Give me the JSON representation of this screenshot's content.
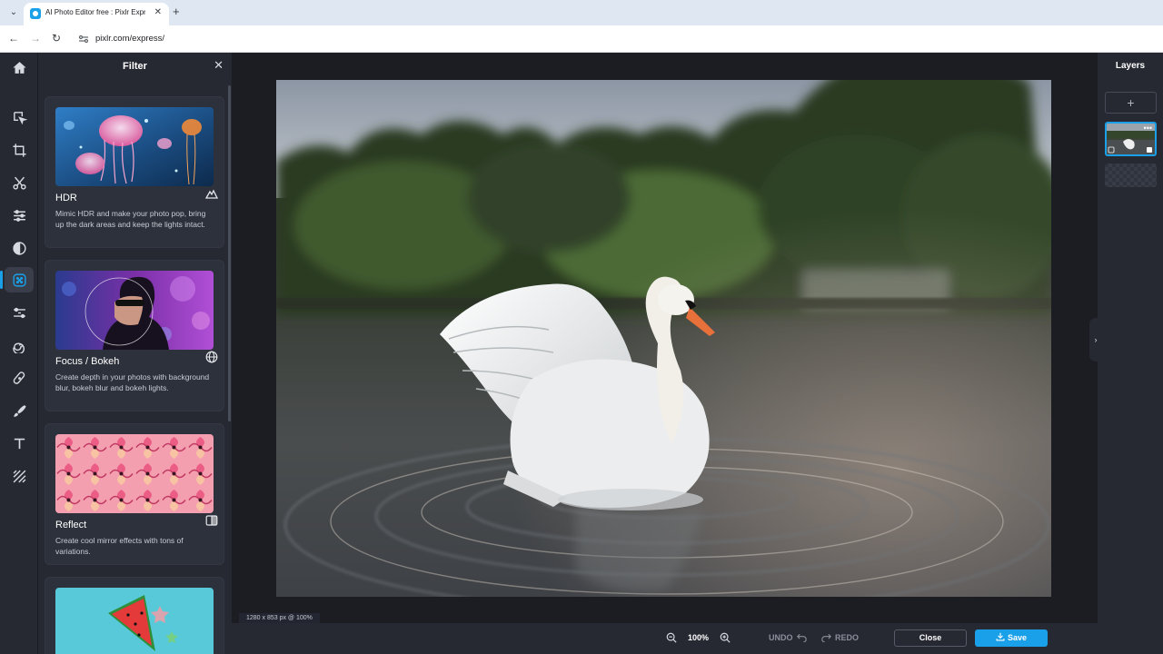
{
  "browser": {
    "tab_title": "AI Photo Editor free : Pixlr Expre",
    "tab_close": "✕",
    "new_tab": "+",
    "dropdown": "⌄",
    "url": "pixlr.com/express/",
    "back": "←",
    "forward": "→",
    "reload": "↻"
  },
  "toolbar": {
    "home": "home-icon",
    "tools": [
      "arrange",
      "crop",
      "cutout",
      "adjust",
      "filter",
      "effect",
      "liquify",
      "heal",
      "draw",
      "text",
      "pattern"
    ],
    "active": "filter"
  },
  "filter_panel": {
    "title": "Filter",
    "close": "✕",
    "cards": [
      {
        "name": "HDR",
        "description": "Mimic HDR and make your photo pop, bring up the dark areas and keep the lights intact."
      },
      {
        "name": "Focus / Bokeh",
        "description": "Create depth in your photos with background blur, bokeh blur and bokeh lights."
      },
      {
        "name": "Reflect",
        "description": "Create cool mirror effects with tons of variations."
      }
    ]
  },
  "canvas": {
    "info": "1280 x 853 px @ 100%"
  },
  "bottom_bar": {
    "zoom": "100%",
    "undo": "UNDO",
    "redo": "REDO",
    "close": "Close",
    "save": "Save"
  },
  "layers": {
    "title": "Layers",
    "add": "+",
    "more": "•••"
  },
  "colors": {
    "accent": "#1aa0e8",
    "panel_bg": "#262932",
    "workspace_bg": "#1b1d23"
  }
}
